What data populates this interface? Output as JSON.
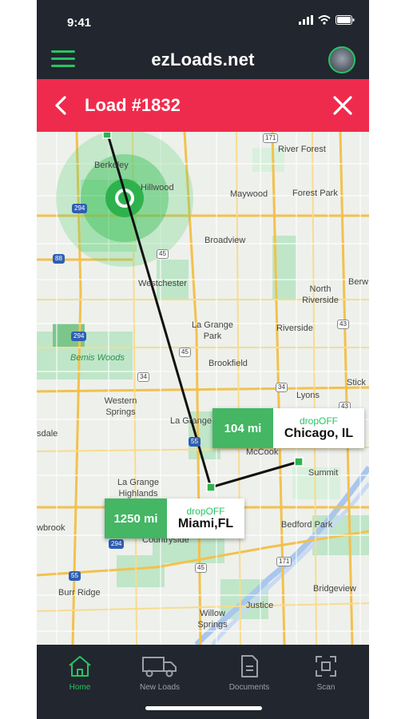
{
  "status_bar": {
    "time": "9:41"
  },
  "header": {
    "title": "ezLoads.net"
  },
  "load_bar": {
    "title": "Load #1832"
  },
  "map": {
    "labels": [
      "River Forest",
      "Maywood",
      "Forest Park",
      "Berkeley",
      "Hillwood",
      "Broadview",
      "Westchester",
      "North Riverside",
      "Berw",
      "La Grange Park",
      "Riverside",
      "Bemis Woods",
      "Brookfield",
      "Lyons",
      "Stick",
      "Western Springs",
      "La Grange",
      "McCook",
      "Summit",
      "sdale",
      "La Grange Highlands",
      "Countryside",
      "wbrook",
      "Bedford Park",
      "Burr Ridge",
      "Willow Springs",
      "Justice",
      "Bridgeview"
    ],
    "shields": [
      "171",
      "294",
      "45",
      "88",
      "294",
      "45",
      "34",
      "34",
      "43",
      "43",
      "55",
      "294",
      "55",
      "171",
      "45"
    ]
  },
  "routes": [
    {
      "distance": "104 mi",
      "type_label": "dropOFF",
      "city": "Chicago, IL"
    },
    {
      "distance": "1250 mi",
      "type_label": "dropOFF",
      "city": "Miami,FL"
    }
  ],
  "tabs": [
    {
      "label": "Home",
      "icon": "home-icon",
      "active": true
    },
    {
      "label": "New Loads",
      "icon": "truck-icon",
      "active": false
    },
    {
      "label": "Documents",
      "icon": "document-icon",
      "active": false
    },
    {
      "label": "Scan",
      "icon": "scan-icon",
      "active": false
    }
  ],
  "colors": {
    "accent": "#27c464",
    "alert": "#ef2b4d",
    "dark": "#22262e"
  }
}
